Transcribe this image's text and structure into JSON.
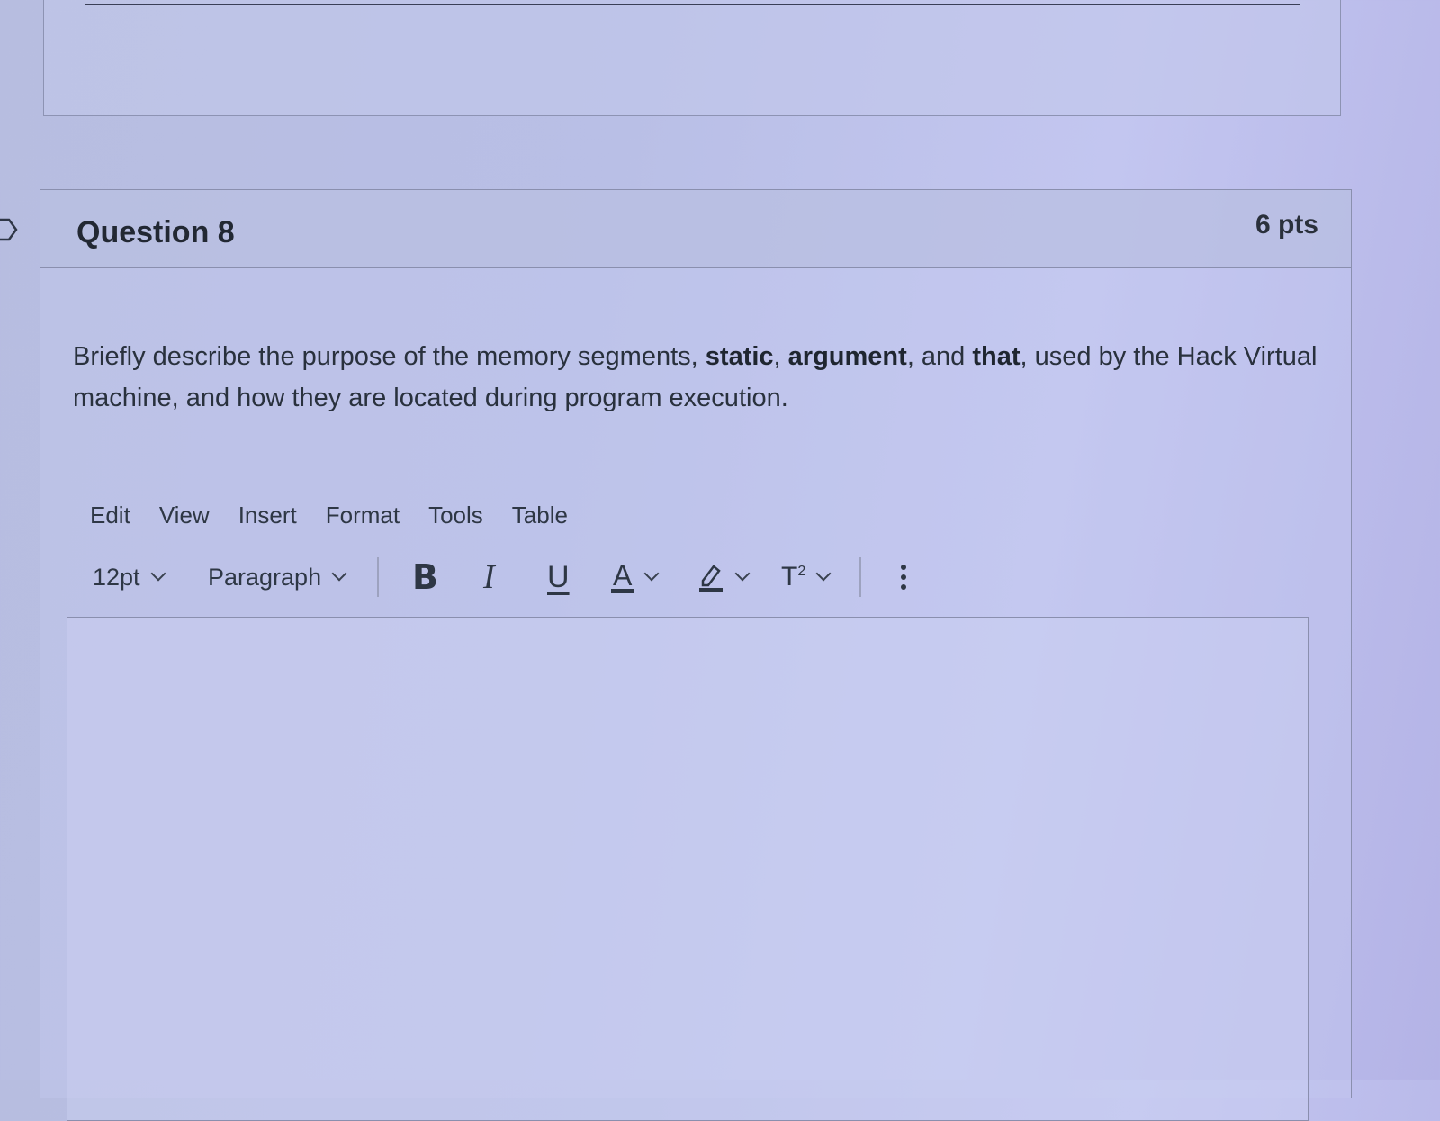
{
  "question": {
    "title": "Question 8",
    "points": "6 pts",
    "text_parts": {
      "p1": "Briefly describe the purpose of the memory segments, ",
      "b1": "static",
      "p2": ", ",
      "b2": "argument",
      "p3": ", and ",
      "b3": "that",
      "p4": ", used by the Hack Virtual machine, and how they are located during program execution."
    }
  },
  "editor": {
    "menu": [
      "Edit",
      "View",
      "Insert",
      "Format",
      "Tools",
      "Table"
    ],
    "font_size": "12pt",
    "block_format": "Paragraph",
    "buttons": {
      "bold": "B",
      "italic": "I",
      "underline": "U",
      "text_color": "A",
      "superscript": "T",
      "superscript_exp": "2"
    },
    "content": ""
  },
  "colors": {
    "text": "#2d3b45",
    "border": "#8a8fae"
  }
}
